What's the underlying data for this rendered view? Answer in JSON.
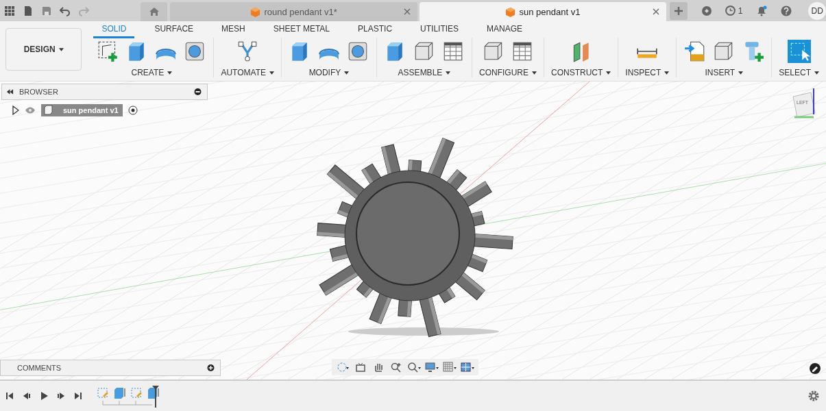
{
  "document_tabs": [
    {
      "title": "round pendant v1*",
      "selected": false
    },
    {
      "title": "sun pendant v1",
      "selected": true
    }
  ],
  "job_status": {
    "count": "1"
  },
  "notifications": {
    "unread": true
  },
  "account": {
    "initials": "DD"
  },
  "workspace": {
    "label": "DESIGN"
  },
  "ribbon_tabs": [
    {
      "label": "SOLID",
      "selected": true
    },
    {
      "label": "SURFACE",
      "selected": false
    },
    {
      "label": "MESH",
      "selected": false
    },
    {
      "label": "SHEET METAL",
      "selected": false
    },
    {
      "label": "PLASTIC",
      "selected": false
    },
    {
      "label": "UTILITIES",
      "selected": false
    },
    {
      "label": "MANAGE",
      "selected": false
    }
  ],
  "ribbon_groups": [
    {
      "kind": "create",
      "label": "CREATE"
    },
    {
      "kind": "automate",
      "label": "AUTOMATE"
    },
    {
      "kind": "modify",
      "label": "MODIFY"
    },
    {
      "kind": "assemble",
      "label": "ASSEMBLE"
    },
    {
      "kind": "configure",
      "label": "CONFIGURE"
    },
    {
      "kind": "construct",
      "label": "CONSTRUCT"
    },
    {
      "kind": "inspect",
      "label": "INSPECT"
    },
    {
      "kind": "insert",
      "label": "INSERT"
    },
    {
      "kind": "select",
      "label": "SELECT"
    }
  ],
  "browser": {
    "title": "BROWSER",
    "items": [
      {
        "name": "sun pendant v1",
        "expanded": false
      }
    ]
  },
  "comments": {
    "title": "COMMENTS"
  },
  "viewcube": {
    "face": "LEFT"
  }
}
